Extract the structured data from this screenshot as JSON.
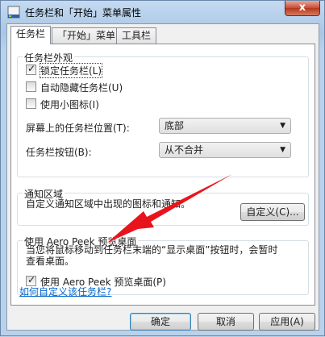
{
  "window": {
    "title": "任务栏和「开始」菜单属性",
    "close_glyph": "x"
  },
  "tabs": [
    {
      "label": "任务栏",
      "active": true
    },
    {
      "label": "「开始」菜单",
      "active": false
    },
    {
      "label": "工具栏",
      "active": false
    }
  ],
  "appearance": {
    "title": "任务栏外观",
    "lock_taskbar": {
      "label": "锁定任务栏(L)",
      "checked": true
    },
    "auto_hide": {
      "label": "自动隐藏任务栏(U)",
      "checked": false
    },
    "small_icons": {
      "label": "使用小图标(I)",
      "checked": false
    },
    "location_label": "屏幕上的任务栏位置(T):",
    "location_value": "底部",
    "buttons_label": "任务栏按钮(B):",
    "buttons_value": "从不合并"
  },
  "notification": {
    "title": "通知区域",
    "description": "自定义通知区域中出现的图标和通知。",
    "customize_button": "自定义(C)..."
  },
  "aero_peek": {
    "title": "使用 Aero Peek 预览桌面",
    "description_line1": "当您将鼠标移动到任务栏末端的“显示桌面”按钮时，会暂时",
    "description_line2": "查看桌面。",
    "checkbox": {
      "label": "使用 Aero Peek 预览桌面(P)",
      "checked": true
    }
  },
  "help_link": "如何自定义该任务栏?",
  "footer": {
    "ok": "确定",
    "cancel": "取消",
    "apply": "应用(A)"
  },
  "colors": {
    "arrow": "#e8141c",
    "link": "#0066cc"
  }
}
